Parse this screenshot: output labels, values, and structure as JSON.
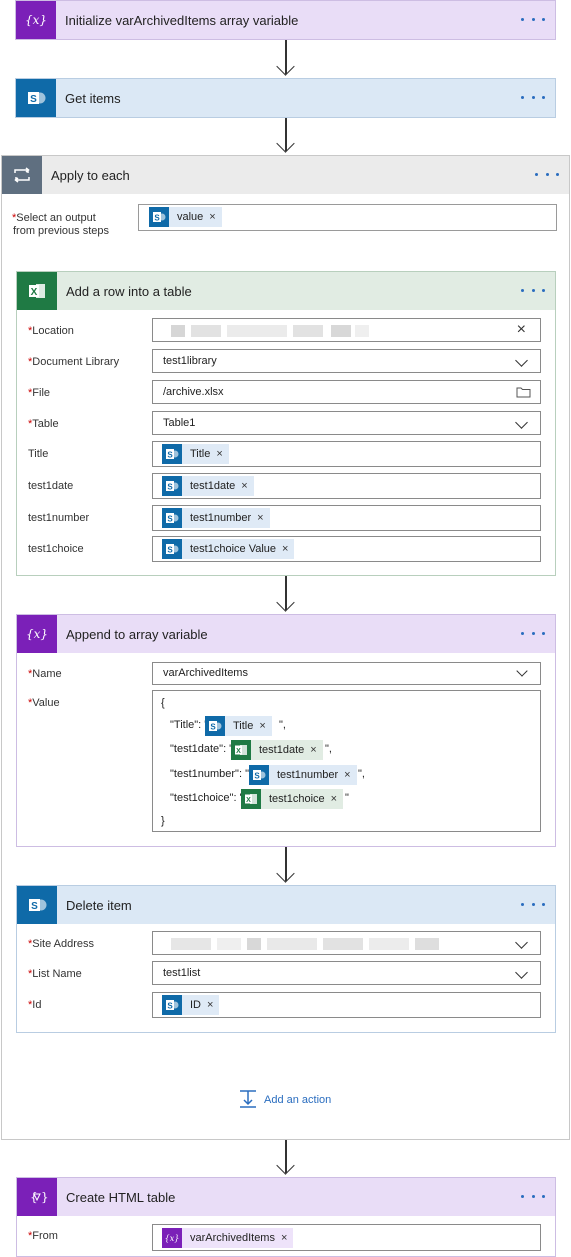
{
  "steps": {
    "init": {
      "title": "Initialize varArchivedItems array variable",
      "icon": "variable-icon"
    },
    "get_items": {
      "title": "Get items",
      "icon": "sharepoint-icon"
    },
    "apply": {
      "title": "Apply to each",
      "select_label_1": "Select an output",
      "select_label_2": "from previous steps",
      "select_token": "value"
    },
    "add_row": {
      "title": "Add a row into a table",
      "location_label": "Location",
      "doclib_label": "Document Library",
      "doclib_value": "test1library",
      "file_label": "File",
      "file_value": "/archive.xlsx",
      "table_label": "Table",
      "table_value": "Table1",
      "title_label": "Title",
      "title_token": "Title",
      "date_label": "test1date",
      "date_token": "test1date",
      "number_label": "test1number",
      "number_token": "test1number",
      "choice_label": "test1choice",
      "choice_token": "test1choice Value"
    },
    "append": {
      "title": "Append to array variable",
      "name_label": "Name",
      "name_value": "varArchivedItems",
      "value_label": "Value",
      "open_brace": "{",
      "close_brace": "}",
      "k_title": "\"Title\": \"",
      "t_title": "Title",
      "k_date": "\"test1date\": \"",
      "t_date": "test1date",
      "k_number": "\"test1number\": \"",
      "t_number": "test1number",
      "k_choice": "\"test1choice\": \"",
      "t_choice": "test1choice",
      "end_quote_comma": "\",",
      "end_quote": "\""
    },
    "delete": {
      "title": "Delete item",
      "site_label": "Site Address",
      "list_label": "List Name",
      "list_value": "test1list",
      "id_label": "Id",
      "id_token": "ID"
    },
    "add_action": "Add an action",
    "html_table": {
      "title": "Create HTML table",
      "from_label": "From",
      "from_token": "varArchivedItems"
    }
  },
  "required_mark": "*",
  "remove_glyph": "×",
  "colors": {
    "variable": "#7b20b8",
    "sharepoint": "#0f6aa8",
    "excel": "#1f7a44",
    "control": "#5f6f80",
    "link": "#2a6dbf"
  }
}
